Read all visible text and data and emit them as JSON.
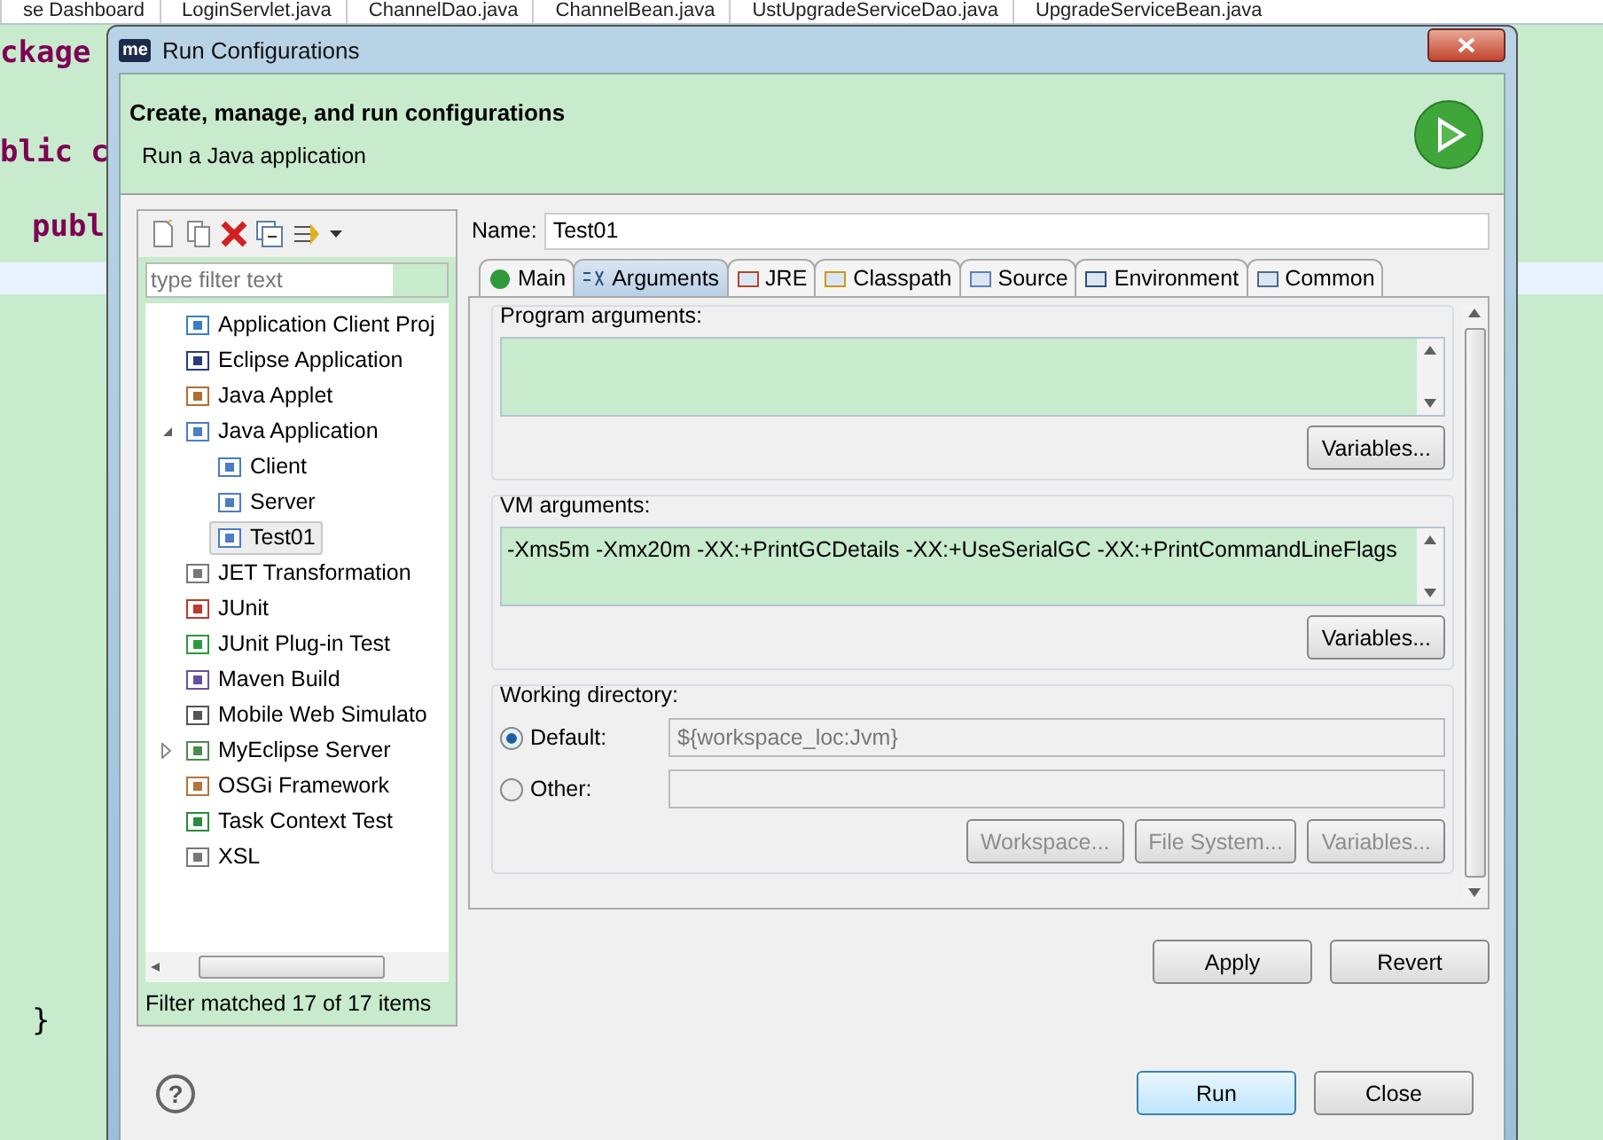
{
  "editor": {
    "tabs": [
      "se Dashboard",
      "LoginServlet.java",
      "ChannelDao.java",
      "ChannelBean.java",
      "UstUpgradeServiceDao.java",
      "UpgradeServiceBean.java"
    ],
    "code_lines": [
      {
        "kind": "keyword",
        "text": "ckage",
        "indent": false
      },
      {
        "kind": "blank"
      },
      {
        "kind": "keyword",
        "text": "blic c",
        "indent": false
      },
      {
        "kind": "keyword",
        "text": "publ",
        "indent": true
      },
      {
        "kind": "current"
      },
      {
        "kind": "spacer"
      },
      {
        "kind": "plain",
        "text": "}",
        "indent": true
      }
    ]
  },
  "dialog": {
    "title": "Run Configurations",
    "app_badge": "me",
    "header": {
      "title": "Create, manage, and run configurations",
      "subtitle": "Run a Java application"
    },
    "filter": {
      "placeholder": "type filter text"
    },
    "tree": [
      {
        "label": "Application Client Proj"
      },
      {
        "label": "Eclipse Application"
      },
      {
        "label": "Java Applet"
      },
      {
        "label": "Java Application",
        "expanded": true,
        "children": [
          {
            "label": "Client",
            "selected": false
          },
          {
            "label": "Server",
            "selected": false
          },
          {
            "label": "Test01",
            "selected": true
          }
        ]
      },
      {
        "label": "JET Transformation"
      },
      {
        "label": "JUnit"
      },
      {
        "label": "JUnit Plug-in Test"
      },
      {
        "label": "Maven Build"
      },
      {
        "label": "Mobile Web Simulato"
      },
      {
        "label": "MyEclipse Server",
        "expanded": false
      },
      {
        "label": "OSGi Framework"
      },
      {
        "label": "Task Context Test"
      },
      {
        "label": "XSL"
      }
    ],
    "filter_status": "Filter matched 17 of 17 items",
    "name": {
      "label": "Name:",
      "value": "Test01"
    },
    "tabs": [
      {
        "label": "Main",
        "selected": false
      },
      {
        "label": "Arguments",
        "selected": true
      },
      {
        "label": "JRE",
        "selected": false
      },
      {
        "label": "Classpath",
        "selected": false
      },
      {
        "label": "Source",
        "selected": false
      },
      {
        "label": "Environment",
        "selected": false
      },
      {
        "label": "Common",
        "selected": false
      }
    ],
    "program_arguments": {
      "label": "Program arguments:",
      "button": "Variables..."
    },
    "vm_arguments": {
      "label": "VM arguments:",
      "value": "-Xms5m -Xmx20m -XX:+PrintGCDetails -XX:+UseSerialGC -XX:+PrintCommandLineFlags",
      "button": "Variables..."
    },
    "working_directory": {
      "label": "Working directory:",
      "options": [
        {
          "label": "Default:",
          "selected": true,
          "value": "${workspace_loc:Jvm}"
        },
        {
          "label": "Other:",
          "selected": false
        }
      ],
      "buttons": [
        {
          "label": "Workspace...",
          "disabled": true
        },
        {
          "label": "File System...",
          "disabled": true
        },
        {
          "label": "Variables...",
          "disabled": true
        }
      ]
    },
    "actions": [
      {
        "label": "Apply",
        "primary": false
      },
      {
        "label": "Revert",
        "primary": false
      }
    ],
    "footer_buttons": [
      {
        "label": "Run",
        "primary": true
      },
      {
        "label": "Close",
        "primary": false
      }
    ],
    "help": "?"
  }
}
